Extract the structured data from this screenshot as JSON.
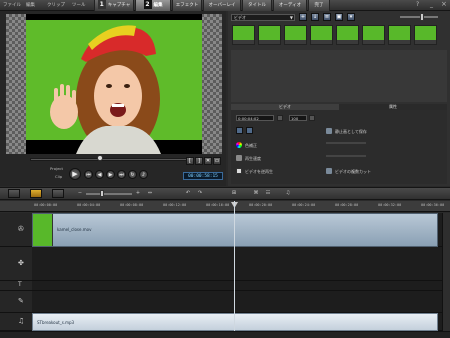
{
  "menu": {
    "items": [
      "ファイル",
      "編集",
      "クリップ",
      "ツール"
    ],
    "steps": [
      {
        "num": "1",
        "label": "キャプチャ"
      },
      {
        "num": "2",
        "label": "編集"
      },
      {
        "label": "エフェクト"
      },
      {
        "label": "オーバーレイ"
      },
      {
        "label": "タイトル"
      },
      {
        "label": "オーディオ"
      },
      {
        "label": "完了"
      }
    ]
  },
  "preview": {
    "project_label": "Project",
    "clip_label": "Clip",
    "timecode": "00:00:58:15"
  },
  "library": {
    "dropdown_value": "ビデオ"
  },
  "properties": {
    "tabs": [
      "ビデオ",
      "属性"
    ],
    "time_value": "0:00:04:02",
    "speed_value": "100",
    "left_options": [
      "色補正",
      "再生速度",
      "ビデオを逆再生"
    ],
    "right_options": [
      "静止画として保存",
      "ビデオの複数カット"
    ]
  },
  "ruler": {
    "ticks": [
      "00:00:00:00",
      "00:00:04:00",
      "00:00:08:00",
      "00:00:12:00",
      "00:00:16:00",
      "00:00:20:00",
      "00:00:24:00",
      "00:00:28:00",
      "00:00:32:00",
      "00:00:36:00"
    ]
  },
  "timeline": {
    "video_clip_name": "kamel_close.mov",
    "audio_clip_name": "STbreakout_s.mp3"
  },
  "colors": {
    "accent_orange": "#e0a020",
    "green_screen": "#5fbb2a",
    "timecode_blue": "#7fd0ff"
  }
}
